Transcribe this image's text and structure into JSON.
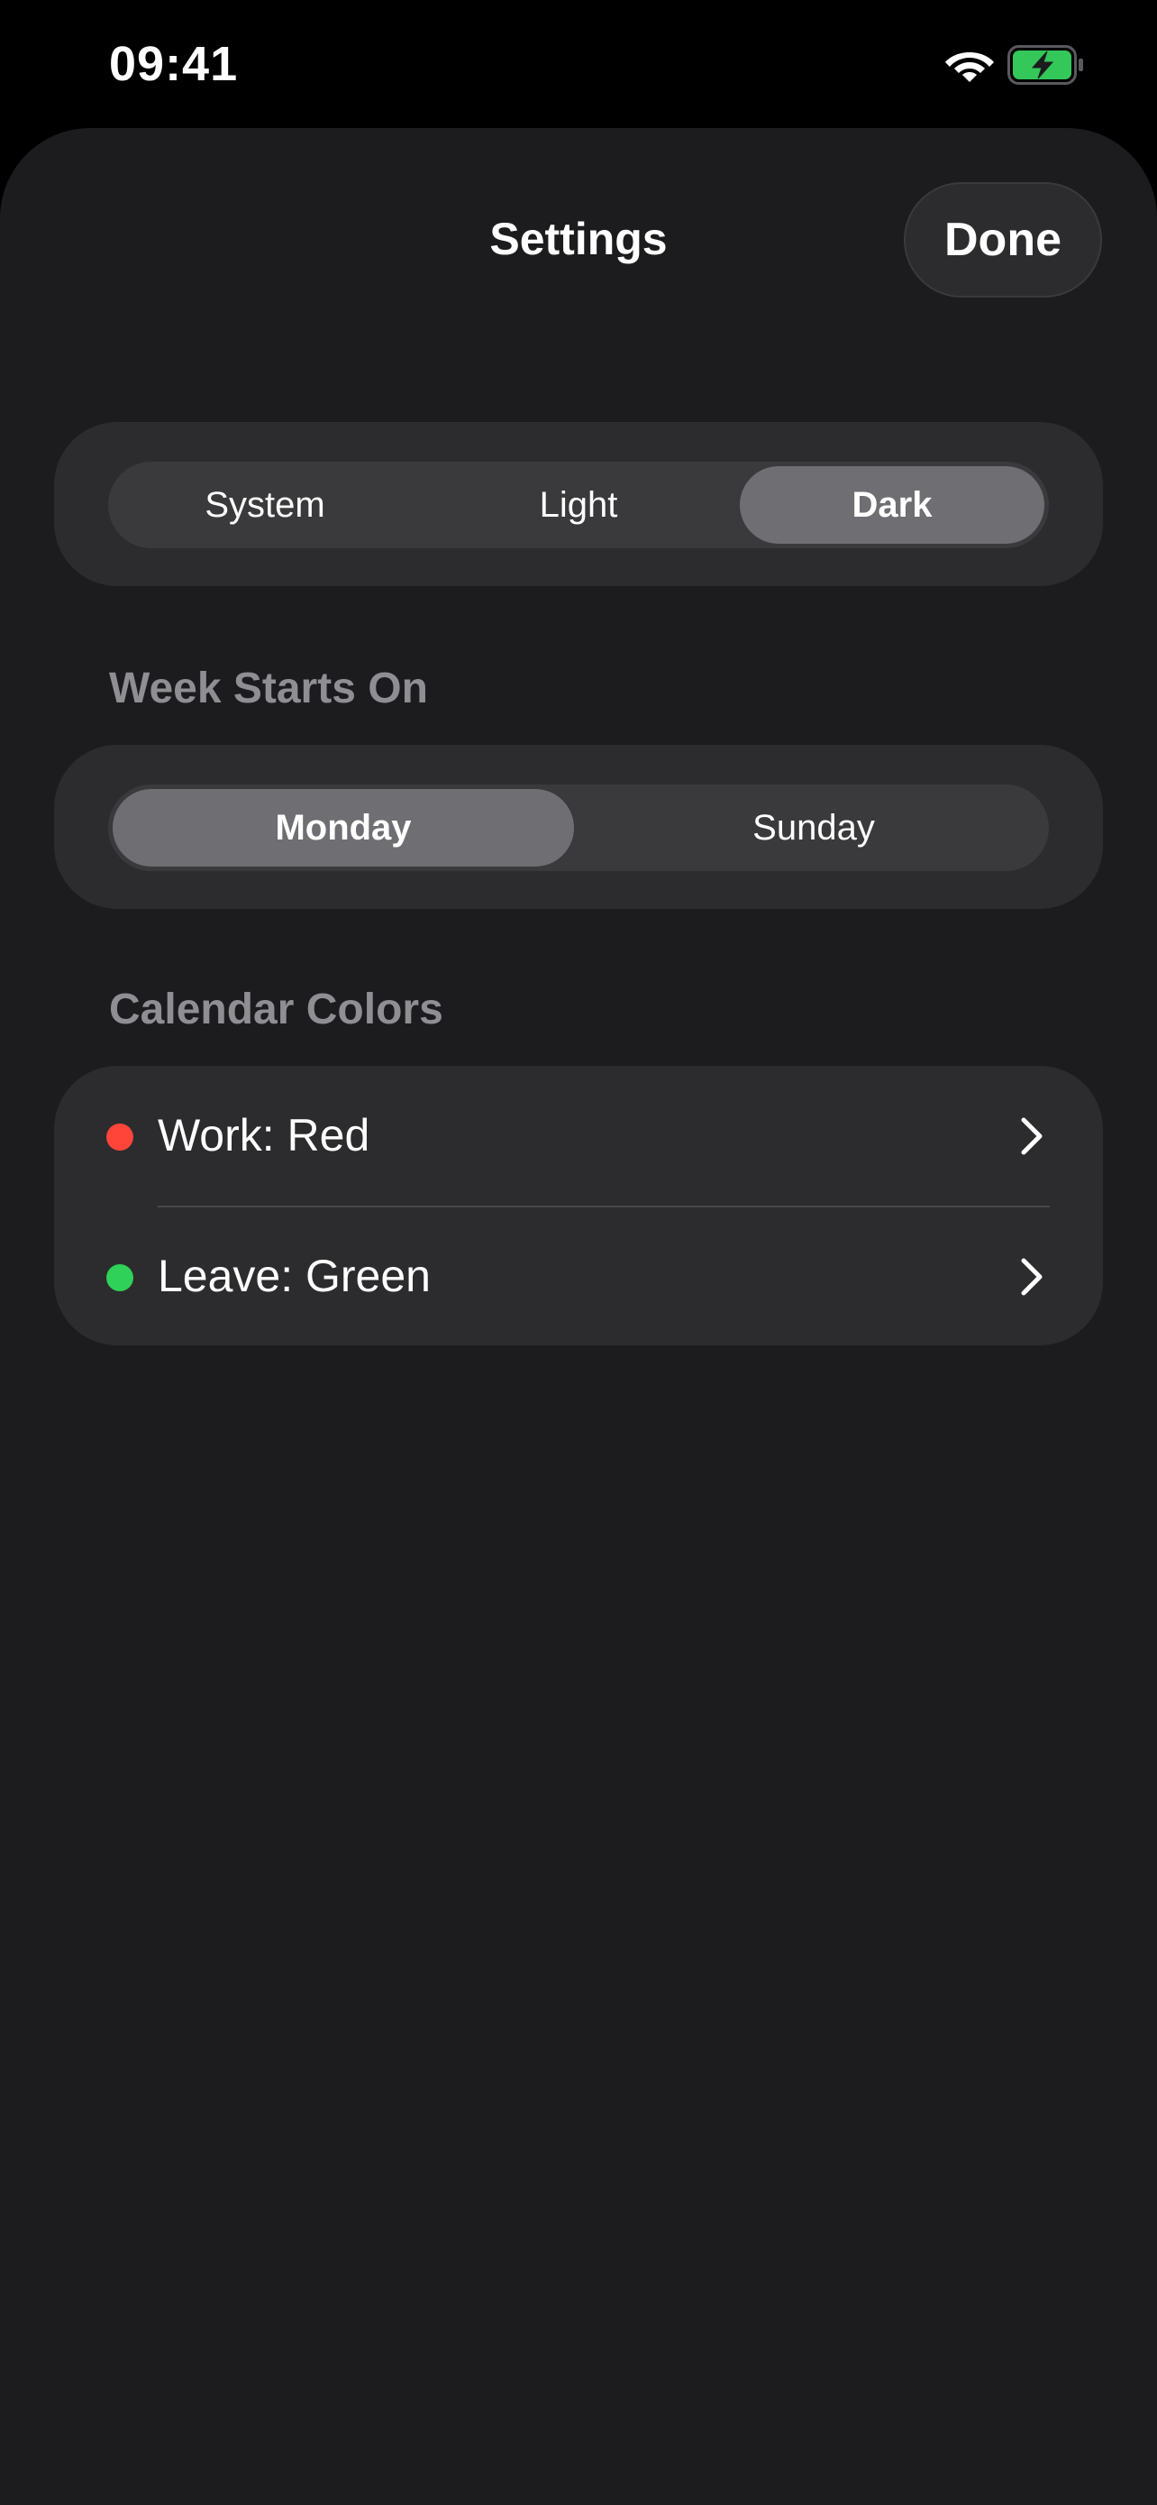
{
  "status_bar": {
    "time": "09:41",
    "wifi_icon": "wifi-icon",
    "battery_icon": "battery-charging-icon",
    "battery_color": "#34c759"
  },
  "nav": {
    "title": "Settings",
    "done_label": "Done"
  },
  "appearance": {
    "options": [
      "System",
      "Light",
      "Dark"
    ],
    "selected": "Dark"
  },
  "week_start": {
    "header": "Week Starts On",
    "options": [
      "Monday",
      "Sunday"
    ],
    "selected": "Monday"
  },
  "calendar_colors": {
    "header": "Calendar Colors",
    "items": [
      {
        "label": "Work: Red",
        "color": "#ff453a",
        "icon": "chevron-right-icon"
      },
      {
        "label": "Leave: Green",
        "color": "#30d158",
        "icon": "chevron-right-icon"
      }
    ]
  }
}
